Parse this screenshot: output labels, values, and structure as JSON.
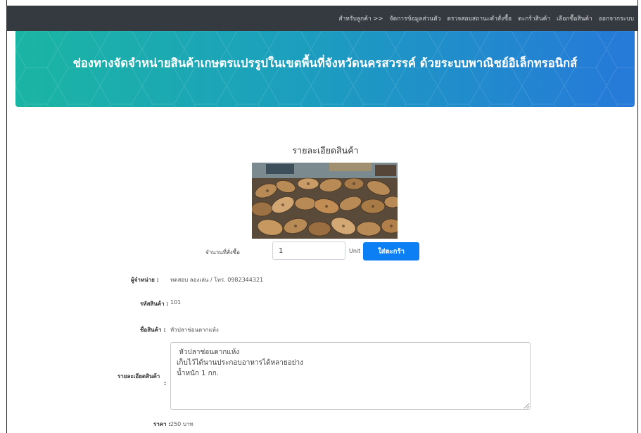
{
  "nav": {
    "items": [
      "สำหรับลูกค้า >>",
      "จัดการข้อมูลส่วนตัว",
      "ตรวจสอบสถานะคำสั่งซื้อ",
      "ตะกร้าสินค้า",
      "เลือกซื้อสินค้า",
      "ออกจากระบบ"
    ]
  },
  "banner": {
    "title": "ช่องทางจัดจำหน่ายสินค้าเกษตรแปรรูปในเขตพื้นที่จังหวัดนครสวรรค์ ด้วยระบบพาณิชย์อิเล็กทรอนิกส์"
  },
  "product": {
    "section_title": "รายละเอียดสินค้า",
    "image_alt": "หัวปลาช่อนตากแห้ง",
    "quantity_label": "จำนวนที่สั่งซื้อ",
    "quantity_value": "1",
    "unit_label": "Unit",
    "add_to_cart_label": "ใส่ตะกร้า",
    "seller_label": "ผู้จำหน่าย :",
    "seller_value": "ทดสอบ ลองเล่น / โทร. 0982344321",
    "code_label": "รหัสสินค้า :",
    "code_value": "101",
    "name_label": "ชื่อสินค้า :",
    "name_value": "หัวปลาช่อนตากแห้ง",
    "detail_label": "รายละเอียดสินค้า",
    "detail_colon": ":",
    "detail_text": " หัวปลาช่อนตากแห้ง\nเก็บไว้ได้นานประกอบอาหารได้หลายอย่าง\nน้ำหนัก 1 กก.",
    "price_label": "ราคา :",
    "price_value": "250 บาท"
  },
  "colors": {
    "navbar": "#343a40",
    "banner_start": "#1bb5a3",
    "banner_end": "#2679d9",
    "button": "#0d7ff5"
  }
}
